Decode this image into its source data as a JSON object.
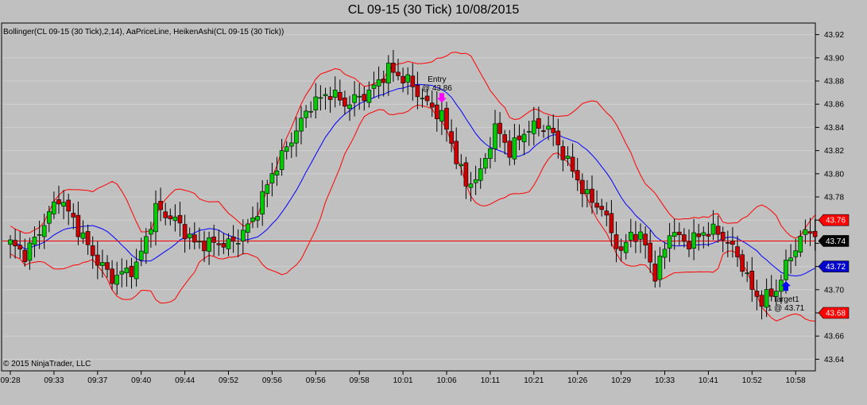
{
  "title": "CL 09-15 (30 Tick)  10/08/2015",
  "indicators_label": "Bollinger(CL 09-15 (30 Tick),2,14), AaPriceLine, HeikenAshi(CL 09-15 (30 Tick))",
  "copyright": "© 2015 NinjaTrader, LLC",
  "chart_data": {
    "type": "candlestick",
    "title": "CL 09-15 (30 Tick)  10/08/2015",
    "ylim": [
      43.63,
      43.93
    ],
    "y_ticks": [
      {
        "value": 43.64,
        "label": "43.64"
      },
      {
        "value": 43.66,
        "label": "43.66"
      },
      {
        "value": 43.68,
        "label": "43.68"
      },
      {
        "value": 43.7,
        "label": "43.70"
      },
      {
        "value": 43.72,
        "label": "43.72"
      },
      {
        "value": 43.74,
        "label": "43.74"
      },
      {
        "value": 43.76,
        "label": "43.76"
      },
      {
        "value": 43.78,
        "label": "43.78"
      },
      {
        "value": 43.8,
        "label": "43.80"
      },
      {
        "value": 43.82,
        "label": "43.82"
      },
      {
        "value": 43.84,
        "label": "43.84"
      },
      {
        "value": 43.86,
        "label": "43.86"
      },
      {
        "value": 43.88,
        "label": "43.88"
      },
      {
        "value": 43.9,
        "label": "43.90"
      },
      {
        "value": 43.92,
        "label": "43.92"
      }
    ],
    "x_ticks": [
      {
        "bar": 0,
        "label": "09:28"
      },
      {
        "bar": 9,
        "label": "09:33"
      },
      {
        "bar": 18,
        "label": "09:37"
      },
      {
        "bar": 27,
        "label": "09:40"
      },
      {
        "bar": 36,
        "label": "09:44"
      },
      {
        "bar": 45,
        "label": "09:52"
      },
      {
        "bar": 54,
        "label": "09:56"
      },
      {
        "bar": 63,
        "label": "09:56"
      },
      {
        "bar": 72,
        "label": "09:58"
      },
      {
        "bar": 81,
        "label": "10:01"
      },
      {
        "bar": 90,
        "label": "10:06"
      },
      {
        "bar": 99,
        "label": "10:11"
      },
      {
        "bar": 108,
        "label": "10:21"
      },
      {
        "bar": 117,
        "label": "10:26"
      },
      {
        "bar": 126,
        "label": "10:29"
      },
      {
        "bar": 135,
        "label": "10:33"
      },
      {
        "bar": 144,
        "label": "10:41"
      },
      {
        "bar": 153,
        "label": "10:52"
      },
      {
        "bar": 162,
        "label": "10:58"
      }
    ],
    "bar_count": 167,
    "close_anchors": [
      [
        0,
        43.74
      ],
      [
        3,
        43.73
      ],
      [
        6,
        43.75
      ],
      [
        10,
        43.78
      ],
      [
        13,
        43.76
      ],
      [
        17,
        43.73
      ],
      [
        21,
        43.71
      ],
      [
        26,
        43.72
      ],
      [
        30,
        43.77
      ],
      [
        34,
        43.76
      ],
      [
        38,
        43.74
      ],
      [
        42,
        43.74
      ],
      [
        46,
        43.74
      ],
      [
        50,
        43.76
      ],
      [
        54,
        43.8
      ],
      [
        58,
        43.83
      ],
      [
        62,
        43.86
      ],
      [
        66,
        43.87
      ],
      [
        69,
        43.86
      ],
      [
        74,
        43.87
      ],
      [
        78,
        43.89
      ],
      [
        82,
        43.88
      ],
      [
        86,
        43.86
      ],
      [
        89,
        43.85
      ],
      [
        94,
        43.79
      ],
      [
        97,
        43.8
      ],
      [
        100,
        43.84
      ],
      [
        103,
        43.82
      ],
      [
        107,
        43.84
      ],
      [
        111,
        43.84
      ],
      [
        115,
        43.81
      ],
      [
        119,
        43.78
      ],
      [
        122,
        43.77
      ],
      [
        126,
        43.73
      ],
      [
        128,
        43.75
      ],
      [
        131,
        43.74
      ],
      [
        133,
        43.71
      ],
      [
        136,
        43.75
      ],
      [
        140,
        43.74
      ],
      [
        143,
        43.75
      ],
      [
        146,
        43.75
      ],
      [
        150,
        43.73
      ],
      [
        153,
        43.7
      ],
      [
        155,
        43.69
      ],
      [
        158,
        43.7
      ],
      [
        161,
        43.73
      ],
      [
        164,
        43.75
      ],
      [
        166,
        43.75
      ]
    ],
    "series": [
      {
        "name": "HeikenAshi",
        "kind": "candles"
      },
      {
        "name": "Bollinger upper",
        "kind": "line",
        "color": "#ff0000"
      },
      {
        "name": "Bollinger middle",
        "kind": "line",
        "color": "#0000ff"
      },
      {
        "name": "Bollinger lower",
        "kind": "line",
        "color": "#ff0000"
      }
    ],
    "price_line": {
      "value": 43.742,
      "color": "#ff0000"
    },
    "price_badges": [
      {
        "value": 43.76,
        "label": "43.76",
        "color": "#ff0000"
      },
      {
        "value": 43.742,
        "label": "43.74",
        "color": "#000000"
      },
      {
        "value": 43.72,
        "label": "43.72",
        "color": "#0000cc"
      },
      {
        "value": 43.68,
        "label": "43.68",
        "color": "#ff0000"
      }
    ],
    "annotations": [
      {
        "bar": 89,
        "value": 43.86,
        "line1": "Entry",
        "line2": "@ 43.86",
        "side": "above",
        "arrow": "down",
        "color": "#ff00ff"
      },
      {
        "bar": 160,
        "value": 43.71,
        "line1": "Target1",
        "line2": "1 @ 43.71",
        "side": "below",
        "arrow": "up",
        "color": "#0000ff"
      }
    ],
    "colors": {
      "up": "#00cc00",
      "down": "#cc0000",
      "band": "#ff0000",
      "mid": "#0000ff"
    }
  }
}
